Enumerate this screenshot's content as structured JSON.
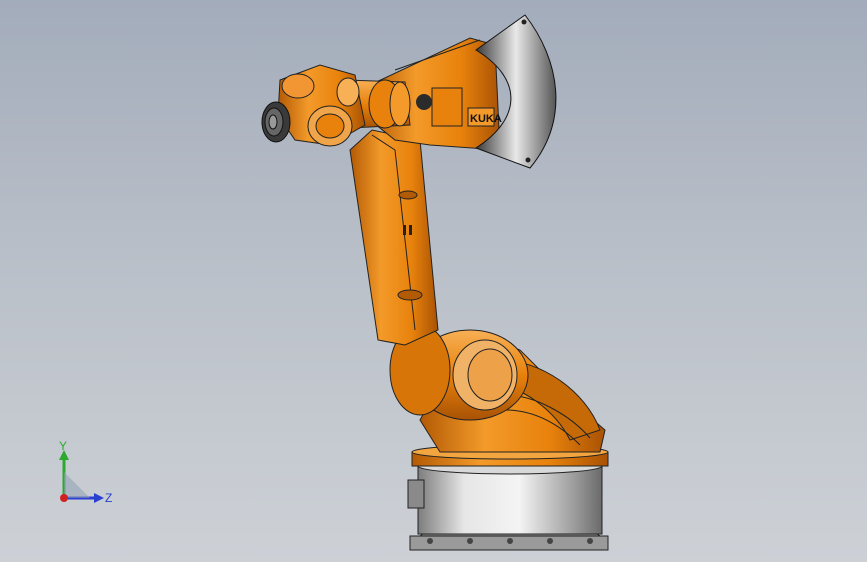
{
  "viewport": {
    "background_top": "#a3acbb",
    "background_bottom": "#cdd1d6"
  },
  "model": {
    "body_color": "#e8820c",
    "body_shadow": "#b35a05",
    "body_highlight": "#f7b055",
    "base_color": "#c9c9c9",
    "brand_text": "KUKA"
  },
  "triad": {
    "y_label": "Y",
    "z_label": "Z",
    "y_color": "#2ea82e",
    "z_color": "#2a3fd0",
    "x_color": "#d02020"
  }
}
